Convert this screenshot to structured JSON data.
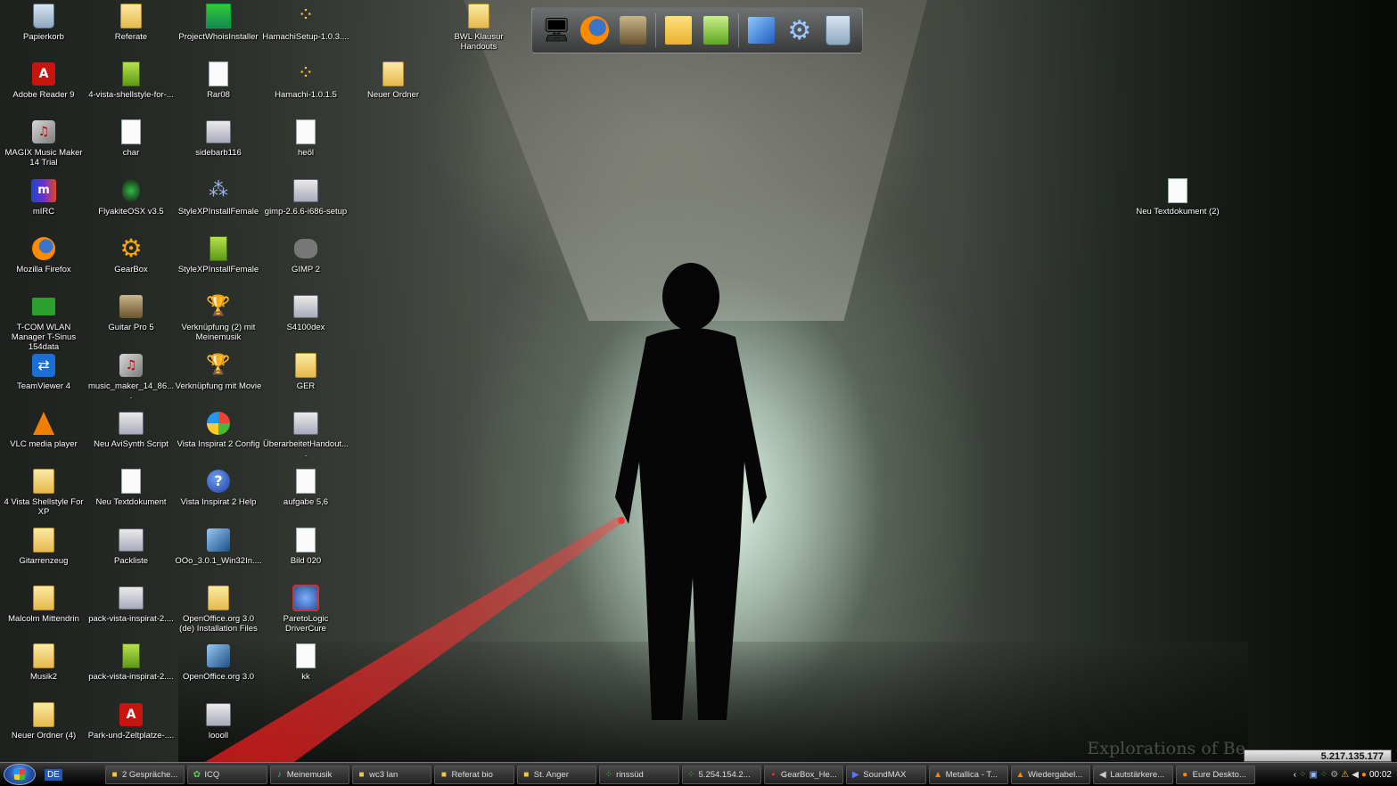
{
  "desktop": {
    "wallpaper_caption": "Explorations of Be",
    "icons": [
      {
        "label": "Papierkorb",
        "icon": "recycle-bin-icon"
      },
      {
        "label": "Referate",
        "icon": "folder-icon"
      },
      {
        "label": "ProjectWhoisInstaller",
        "icon": "installer-icon"
      },
      {
        "label": "HamachiSetup-1.0.3....",
        "icon": "hamachi-icon"
      },
      {
        "label": "BWL Klausur Handouts",
        "icon": "folder-icon"
      },
      {
        "label": "Adobe Reader 9",
        "icon": "pdf-icon"
      },
      {
        "label": "4-vista-shellstyle-for-...",
        "icon": "archive-icon"
      },
      {
        "label": "Rar08",
        "icon": "document-icon"
      },
      {
        "label": "Hamachi-1.0.1.5",
        "icon": "hamachi-icon"
      },
      {
        "label": "Neuer Ordner",
        "icon": "folder-icon"
      },
      {
        "label": "MAGIX Music Maker 14 Trial",
        "icon": "magix-icon"
      },
      {
        "label": "char",
        "icon": "document-icon"
      },
      {
        "label": "sidebarb116",
        "icon": "program-icon"
      },
      {
        "label": "heöl",
        "icon": "document-icon"
      },
      {
        "label": "mIRC",
        "icon": "mirc-icon"
      },
      {
        "label": "FlyakiteOSX v3.5",
        "icon": "flyakite-icon"
      },
      {
        "label": "StyleXPInstallFemale",
        "icon": "program-icon"
      },
      {
        "label": "gimp-2.6.6-i686-setup",
        "icon": "installer-icon"
      },
      {
        "label": "Neu Textdokument (2)",
        "icon": "document-icon"
      },
      {
        "label": "Mozilla Firefox",
        "icon": "firefox-icon"
      },
      {
        "label": "GearBox",
        "icon": "gear-icon"
      },
      {
        "label": "StyleXPInstallFemale",
        "icon": "archive-icon"
      },
      {
        "label": "GIMP 2",
        "icon": "gimp-icon"
      },
      {
        "label": "T-COM WLAN Manager T-Sinus 154data",
        "icon": "wlan-icon"
      },
      {
        "label": "Guitar Pro 5",
        "icon": "guitar-pro-icon"
      },
      {
        "label": "Verknüpfung (2) mit Meinemusik",
        "icon": "shortcut-icon"
      },
      {
        "label": "S4100dex",
        "icon": "program-icon"
      },
      {
        "label": "TeamViewer 4",
        "icon": "teamviewer-icon"
      },
      {
        "label": "music_maker_14_86....",
        "icon": "magix-icon"
      },
      {
        "label": "Verknüpfung mit Movie",
        "icon": "shortcut-icon"
      },
      {
        "label": "GER",
        "icon": "folder-icon"
      },
      {
        "label": "VLC media player",
        "icon": "vlc-icon"
      },
      {
        "label": "Neu AviSynth Script",
        "icon": "program-icon"
      },
      {
        "label": "Vista Inspirat 2 Config",
        "icon": "windows-icon"
      },
      {
        "label": "ÜberarbeitetHandout....",
        "icon": "program-icon"
      },
      {
        "label": "4 Vista Shellstyle For XP",
        "icon": "folder-icon"
      },
      {
        "label": "Neu Textdokument",
        "icon": "document-icon"
      },
      {
        "label": "Vista Inspirat 2 Help",
        "icon": "help-icon"
      },
      {
        "label": "aufgabe 5,6",
        "icon": "document-icon"
      },
      {
        "label": "Gitarrenzeug",
        "icon": "folder-icon"
      },
      {
        "label": "Packliste",
        "icon": "program-icon"
      },
      {
        "label": "OOo_3.0.1_Win32In....",
        "icon": "installer-icon"
      },
      {
        "label": "Bild 020",
        "icon": "document-icon"
      },
      {
        "label": "Malcolm Mittendrin",
        "icon": "folder-icon"
      },
      {
        "label": "pack-vista-inspirat-2....",
        "icon": "program-icon"
      },
      {
        "label": "OpenOffice.org 3.0 (de) Installation Files",
        "icon": "folder-icon"
      },
      {
        "label": "ParetoLogic DriverCure",
        "icon": "paretologic-icon"
      },
      {
        "label": "Musik2",
        "icon": "folder-icon"
      },
      {
        "label": "pack-vista-inspirat-2....",
        "icon": "archive-icon"
      },
      {
        "label": "OpenOffice.org 3.0",
        "icon": "openoffice-icon"
      },
      {
        "label": "kk",
        "icon": "document-icon"
      },
      {
        "label": "Neuer Ordner (4)",
        "icon": "folder-icon"
      },
      {
        "label": "Park-und-Zeltplatze-....",
        "icon": "pdf-icon"
      },
      {
        "label": "loooll",
        "icon": "program-icon"
      }
    ]
  },
  "dock": {
    "items": [
      "my-computer-icon",
      "firefox-icon",
      "guitar-pro-icon",
      "notes-icon",
      "spreadsheet-icon",
      "documents-icon",
      "settings-gear-icon",
      "recycle-bin-icon"
    ]
  },
  "counter_widget": {
    "value": "5.217.135.177"
  },
  "taskbar": {
    "language": "DE",
    "tasks": [
      {
        "label": "2 Gespräche...",
        "icon": "folder-icon"
      },
      {
        "label": "ICQ",
        "icon": "icq-icon"
      },
      {
        "label": "Meinemusik",
        "icon": "shortcut-icon"
      },
      {
        "label": "wc3 lan",
        "icon": "folder-icon"
      },
      {
        "label": "Referat bio",
        "icon": "folder-icon"
      },
      {
        "label": "St. Anger",
        "icon": "folder-icon"
      },
      {
        "label": "rinssüd",
        "icon": "network-icon"
      },
      {
        "label": "5.254.154.2...",
        "icon": "network-icon"
      },
      {
        "label": "GearBox_He...",
        "icon": "pdf-icon"
      },
      {
        "label": "SoundMAX",
        "icon": "soundmax-icon"
      },
      {
        "label": "Metallica - T...",
        "icon": "vlc-icon"
      },
      {
        "label": "Wiedergabel...",
        "icon": "vlc-icon"
      },
      {
        "label": "Lautstärkere...",
        "icon": "volume-icon"
      },
      {
        "label": "Eure Deskto...",
        "icon": "firefox-icon"
      }
    ],
    "clock": "00:02"
  },
  "colors": {
    "taskbar": "#1a1a1a",
    "icon_text": "#ffffff",
    "laser": "#ff2020"
  }
}
